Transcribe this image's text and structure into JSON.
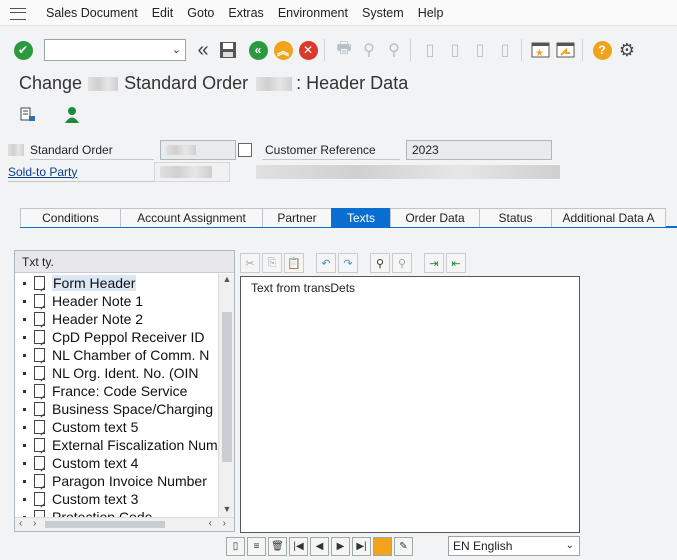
{
  "menu": [
    "Sales Document",
    "Edit",
    "Goto",
    "Extras",
    "Environment",
    "System",
    "Help"
  ],
  "title": {
    "prefix": "Change",
    "middle": "Standard Order",
    "suffix": ": Header Data"
  },
  "fields": {
    "standard_order_label": "Standard Order",
    "customer_reference_label": "Customer Reference",
    "customer_reference_value": "2023",
    "sold_to_party_label": "Sold-to Party"
  },
  "tabs": [
    "Conditions",
    "Account Assignment",
    "Partner",
    "Texts",
    "Order Data",
    "Status",
    "Additional Data A"
  ],
  "active_tab": "Texts",
  "text_panel": {
    "header": "Txt ty.",
    "items": [
      "Form Header",
      "Header Note 1",
      "Header Note 2",
      "CpD Peppol Receiver ID",
      "NL Chamber of Comm. N",
      "NL Org. Ident. No. (OIN",
      "France: Code Service",
      "Business Space/Charging",
      "Custom text 5",
      "External Fiscalization Num",
      "Custom text 4",
      "Paragon Invoice Number",
      "Custom text 3",
      "Protection Code"
    ]
  },
  "editor": {
    "content": "Text from transDets"
  },
  "language": {
    "value": "EN English"
  },
  "colors": {
    "accent": "#0a6ed1",
    "enter_green": "#2b9a3e",
    "nav_back_green": "#2b9a3e",
    "exit_orange": "#f0a31b",
    "cancel_red": "#d93a2b",
    "help_orange": "#f0a31b"
  }
}
